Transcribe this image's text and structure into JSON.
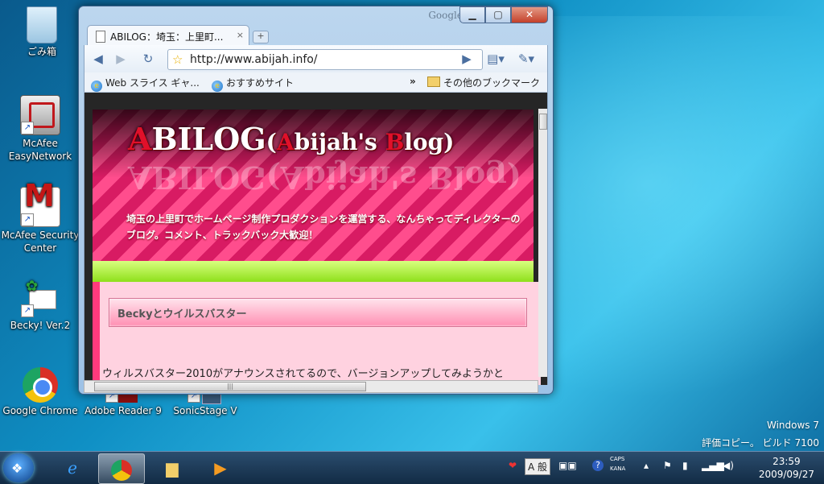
{
  "desktop": {
    "icons": [
      {
        "id": "recycle",
        "label": "ごみ箱"
      },
      {
        "id": "mcafee-en",
        "label": "McAfee EasyNetwork"
      },
      {
        "id": "mcafee-sc",
        "label": "McAfee Security Center"
      },
      {
        "id": "becky",
        "label": "Becky! Ver.2"
      },
      {
        "id": "chrome",
        "label": "Google Chrome"
      },
      {
        "id": "adobe",
        "label": "Adobe Reader 9"
      },
      {
        "id": "sonic",
        "label": "SonicStage V"
      }
    ],
    "watermark_line1": "Windows 7",
    "watermark_line2": "評価コピー。 ビルド 7100"
  },
  "browser": {
    "google_mark": "Google",
    "tab_title": "ABILOG：埼玉：上里町...",
    "tab_close": "×",
    "new_tab": "+",
    "url": "http://www.abijah.info/",
    "bookmarks": {
      "item1": "Web スライス ギャ...",
      "item2": "おすすめサイト",
      "overflow": "»",
      "other": "その他のブックマーク"
    }
  },
  "page": {
    "title_main_A": "A",
    "title_main_rest": "BILOG",
    "title_paren_open": "(",
    "title_sub_A": "A",
    "title_sub_mid": "bijah's ",
    "title_sub_B": "B",
    "title_sub_end": "log)",
    "reflect_text": "ABILOG(Abijah's Blog)",
    "description": "埼玉の上里町でホームページ制作プロダクションを運営する、なんちゃってディレクターのブログ。コメント、トラックバック大歓迎！",
    "post_title": "Beckyとウイルスバスター",
    "post_body": "ウィルスバスター2010がアナウンスされてるので、バージョンアップしてみようかと"
  },
  "taskbar": {
    "tray_ime": "A 般",
    "tray_caps": "CAPS",
    "tray_kana": "KANA",
    "time": "23:59",
    "date": "2009/09/27"
  }
}
